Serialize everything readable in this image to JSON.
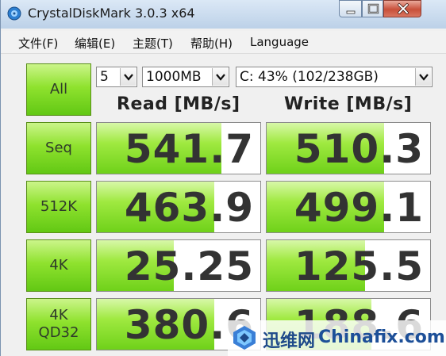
{
  "window": {
    "title": "CrystalDiskMark 3.0.3 x64"
  },
  "menu": {
    "items": [
      "文件(F)",
      "编辑(E)",
      "主题(T)",
      "帮助(H)",
      "Language"
    ]
  },
  "controls": {
    "all_label": "All",
    "count_value": "5",
    "size_value": "1000MB",
    "drive_value": "C: 43% (102/238GB)"
  },
  "columns": {
    "read": "Read [MB/s]",
    "write": "Write [MB/s]"
  },
  "tests": [
    {
      "label": "Seq",
      "label2": "",
      "read": "541.7",
      "write": "510.3",
      "read_fill": 0.76,
      "write_fill": 0.72
    },
    {
      "label": "512K",
      "label2": "",
      "read": "463.9",
      "write": "499.1",
      "read_fill": 0.72,
      "write_fill": 0.72
    },
    {
      "label": "4K",
      "label2": "",
      "read": "25.25",
      "write": "125.5",
      "read_fill": 0.47,
      "write_fill": 0.6
    },
    {
      "label": "4K",
      "label2": "QD32",
      "read": "380.6",
      "write": "188.6",
      "read_fill": 0.72,
      "write_fill": 0.64
    }
  ],
  "watermark": {
    "cn": "迅维网",
    "en": "Chinafix.com"
  },
  "colors": {
    "accent_green": "#8fe22e",
    "close_red": "#c8503a",
    "titlebar_blue": "#bcd1e8"
  }
}
